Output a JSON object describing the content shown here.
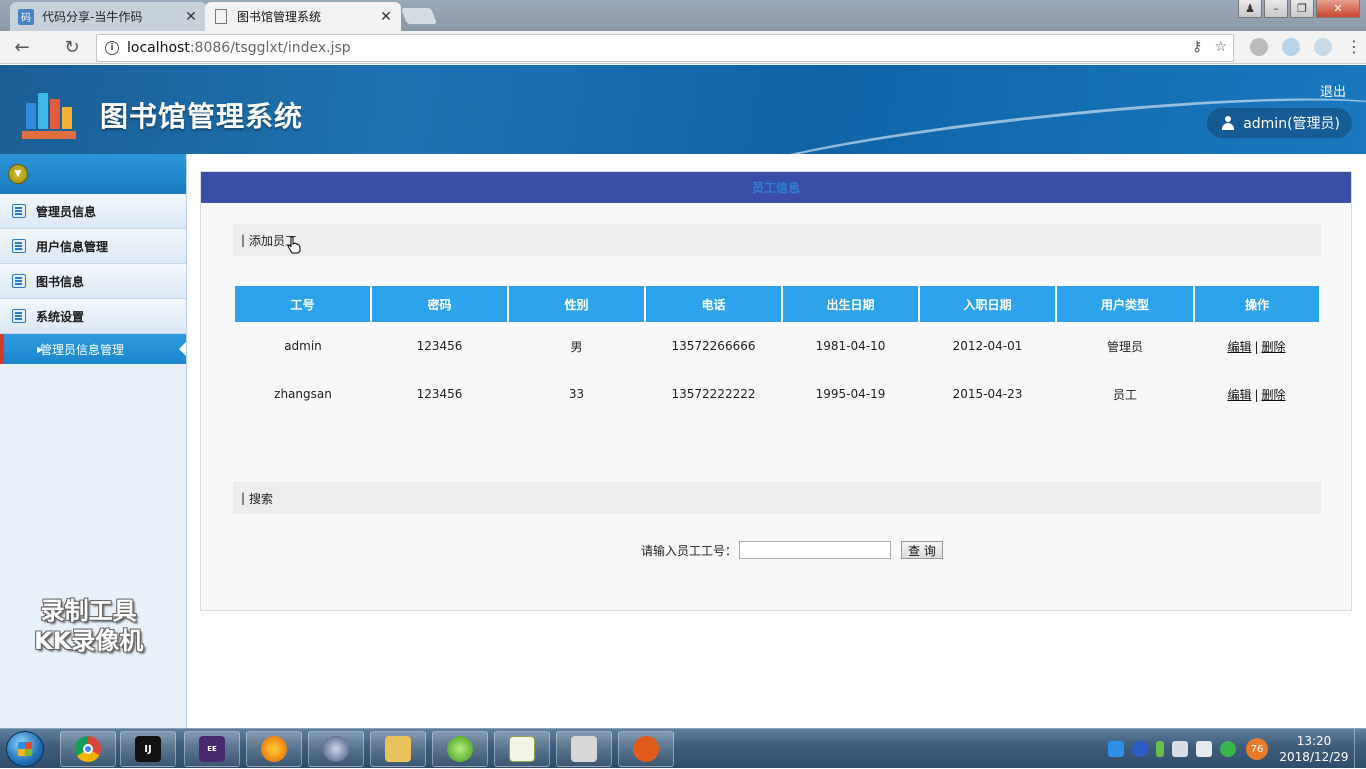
{
  "browser": {
    "tabs": [
      {
        "title": "代码分享-当牛作码",
        "close": "✕"
      },
      {
        "title": "图书馆管理系统",
        "close": "✕"
      }
    ],
    "url_host": "localhost",
    "url_rest": ":8086/tsgglxt/index.jsp"
  },
  "header": {
    "title": "图书馆管理系统",
    "logout": "退出",
    "user": "admin(管理员)"
  },
  "sidebar": {
    "items": [
      {
        "label": "管理员信息"
      },
      {
        "label": "用户信息管理"
      },
      {
        "label": "图书信息"
      },
      {
        "label": "系统设置"
      }
    ],
    "submenu": {
      "label": "管理员信息管理"
    },
    "watermark_line1": "录制工具",
    "watermark_line2": "KK录像机"
  },
  "main": {
    "panel_title": "员工信息",
    "add_section": "添加员工",
    "search_section": "搜索",
    "table": {
      "headers": [
        "工号",
        "密码",
        "性别",
        "电话",
        "出生日期",
        "入职日期",
        "用户类型",
        "操作"
      ],
      "rows": [
        {
          "id": "admin",
          "password": "123456",
          "gender": "男",
          "phone": "13572266666",
          "birth": "1981-04-10",
          "hire": "2012-04-01",
          "type": "管理员"
        },
        {
          "id": "zhangsan",
          "password": "123456",
          "gender": "33",
          "phone": "13572222222",
          "birth": "1995-04-19",
          "hire": "2015-04-23",
          "type": "员工"
        }
      ],
      "edit_label": "编辑",
      "delete_label": "删除"
    },
    "search": {
      "label": "请输入员工工号：",
      "value": "",
      "button": "查 询"
    }
  },
  "taskbar": {
    "badge": "76",
    "time": "13:20",
    "date": "2018/12/29"
  }
}
